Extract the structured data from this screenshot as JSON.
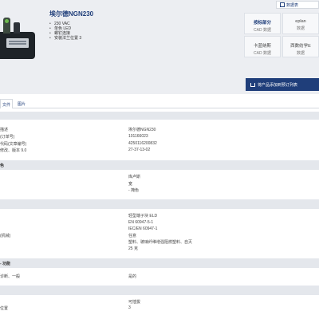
{
  "product": {
    "title": "埃尔德NGN230",
    "features": [
      "230 VAC",
      "单色 LED",
      "螺钉连接",
      "安装法兰位置 3"
    ]
  },
  "downloads": {
    "datasheet_label": "数据表",
    "cards": [
      {
        "title": "按标部分",
        "subtitle": "CAD 数据"
      },
      {
        "title": "eplan",
        "subtitle": "数据"
      },
      {
        "title": "卡蓝纳斯",
        "subtitle": "CAD 数据"
      },
      {
        "title": "西数纺学E",
        "subtitle": "数据"
      }
    ],
    "cart_button": "将产品添加到预订列表"
  },
  "tabs": [
    {
      "label": "文件"
    },
    {
      "label": "图片"
    }
  ],
  "specs": {
    "general_rows": [
      {
        "label": "描述",
        "value": "埃尔德NGN230"
      },
      {
        "label": "(订单号)",
        "value": "101166023"
      },
      {
        "label": "代码(文章编号)",
        "value": "4250116200832"
      },
      {
        "label": "修改、版本 9.0",
        "value": "27-37-13-02"
      }
    ],
    "section_color": {
      "title": "色",
      "rows": [
        {
          "label": "",
          "value": "库卢斯"
        },
        {
          "label": "",
          "value": "宽"
        },
        {
          "label": "",
          "value": "- 掩色"
        }
      ]
    },
    "section_material": {
      "rows": [
        {
          "label": "",
          "value": "轻型端子块 ELD"
        },
        {
          "label": "",
          "value": "EN 60947-5-1"
        },
        {
          "label": "",
          "value": "IEC/EN 60947-1"
        },
        {
          "label": "(机械)",
          "value": "任意"
        },
        {
          "label": "",
          "value": "塑料、玻璃纤维增强阻燃塑料、自灭"
        },
        {
          "label": "",
          "value": "25 克"
        }
      ]
    },
    "section_function": {
      "title": "- 功能",
      "rows": [
        {
          "label": "诊断、一般",
          "value": "是的"
        }
      ]
    },
    "section_mount": {
      "rows": [
        {
          "label": "",
          "value": "可插拔"
        },
        {
          "label": "位置",
          "value": "3"
        }
      ]
    }
  }
}
